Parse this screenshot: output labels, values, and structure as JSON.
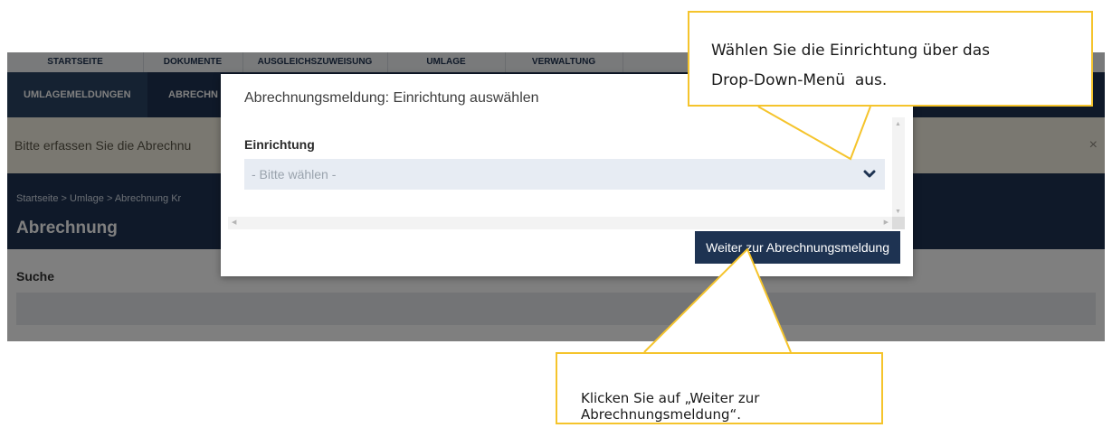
{
  "top_nav": [
    "STARTSEITE",
    "DOKUMENTE",
    "AUSGLEICHSZUWEISUNG",
    "UMLAGE",
    "VERWALTUNG"
  ],
  "sub_nav": [
    "UMLAGEMELDUNGEN",
    "ABRECHN"
  ],
  "notice": {
    "text": "Bitte erfassen Sie die Abrechnu",
    "close": "×"
  },
  "breadcrumb": "Startseite > Umlage > Abrechnung Kr",
  "page_title": "Abrechnung",
  "search_label": "Suche",
  "modal": {
    "title": "Abrechnungsmeldung: Einrichtung auswählen",
    "field_label": "Einrichtung",
    "select_placeholder": "- Bitte wählen -",
    "button_label": "Weiter zur Abrechnungsmeldung"
  },
  "callouts": {
    "top_line1": "Wählen Sie die Einrichtung über das",
    "top_line2": "Drop-Down-Menü  aus.",
    "bottom": "Klicken Sie auf „Weiter zur Abrechnungsmeldung“."
  },
  "colors": {
    "navy": "#1e3352",
    "callout_border": "#f5c42c",
    "select_bg": "#e7ecf3"
  }
}
